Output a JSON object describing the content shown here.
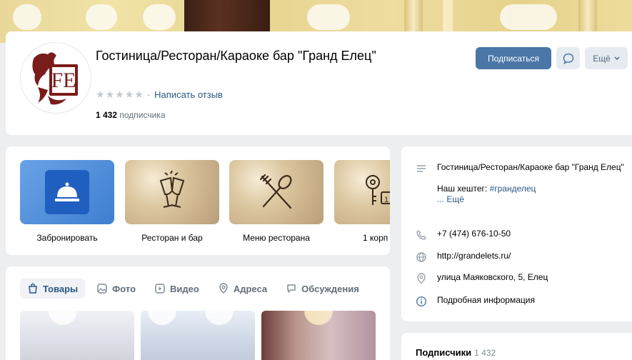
{
  "header": {
    "title": "Гостиница/Ресторан/Караоке бар \"Гранд Елец\"",
    "rating_stars": 0,
    "rating_max": 5,
    "review_link": "Написать отзыв",
    "separator": "·",
    "subscribers_count": "1 432",
    "subscribers_label": "подписчика",
    "subscribe_button": "Подписаться",
    "more_button": "Ещё"
  },
  "apps": [
    {
      "label": "Забронировать",
      "icon": "bell-icon"
    },
    {
      "label": "Ресторан и бар",
      "icon": "champagne-glasses-icon"
    },
    {
      "label": "Меню ресторана",
      "icon": "fork-spoon-icon"
    },
    {
      "label": "1 корп",
      "icon": "keys-icon"
    }
  ],
  "tabs": [
    {
      "label": "Товары",
      "icon": "bag-icon",
      "active": true
    },
    {
      "label": "Фото",
      "icon": "photo-icon",
      "active": false
    },
    {
      "label": "Видео",
      "icon": "video-icon",
      "active": false
    },
    {
      "label": "Адреса",
      "icon": "location-icon",
      "active": false
    },
    {
      "label": "Обсуждения",
      "icon": "comments-icon",
      "active": false
    }
  ],
  "info": {
    "description": "Гостиница/Ресторан/Караоке бар \"Гранд Елец\"",
    "hashtag_prefix": "Наш хештег:",
    "hashtag": "#гранделец",
    "more": "... Ещё",
    "phone": "+7 (474) 676-10-50",
    "website": "http://grandelets.ru/",
    "address": "улица Маяковского, 5, Елец",
    "details": "Подробная информация"
  },
  "subscribers_section": {
    "title": "Подписчики",
    "count": "1 432"
  },
  "colors": {
    "accent": "#4a76a8",
    "link": "#2a5885",
    "background": "#edeef0",
    "card": "#ffffff",
    "logo": "#7a1c1c"
  }
}
